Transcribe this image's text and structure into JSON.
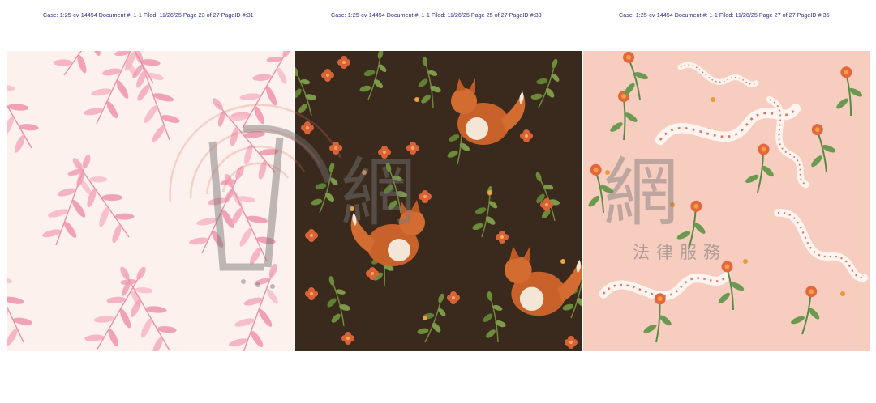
{
  "pages": [
    {
      "header": "Case: 1:25-cv-14454 Document #: 1-1 Filed: 11/26/25 Page 23 of 27 PageID #:31",
      "pattern": "pink-watercolor-leaves-icon"
    },
    {
      "header": "Case: 1:25-cv-14454 Document #: 1-1 Filed: 11/26/25 Page 25 of 27 PageID #:33",
      "pattern": "fox-and-foliage-icon"
    },
    {
      "header": "Case: 1:25-cv-14454 Document #: 1-1 Filed: 11/26/25 Page 27 of 27 PageID #:35",
      "pattern": "snakes-and-flowers-icon"
    }
  ],
  "watermark": {
    "glyph": "網",
    "text": "法律服務",
    "color": "#8a8a8a"
  },
  "colors": {
    "header_text": "#2d2d8f",
    "panel1_bg": "#fdf1ee",
    "panel2_bg": "#3a2a1e",
    "panel3_bg": "#f6cdbf"
  }
}
